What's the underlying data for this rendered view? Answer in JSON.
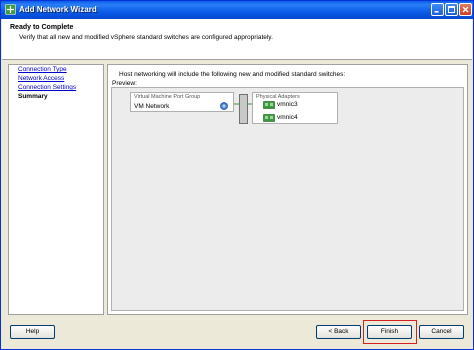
{
  "window": {
    "title": "Add Network Wizard",
    "icon": "network-wizard-icon"
  },
  "header": {
    "title": "Ready to Complete",
    "description": "Verify that all new and modified vSphere standard switches are configured appropriately."
  },
  "nav": {
    "items": [
      {
        "label": "Connection Type",
        "current": false
      },
      {
        "label": "Network Access",
        "current": false
      },
      {
        "label": "Connection Settings",
        "current": false
      },
      {
        "label": "Summary",
        "current": true
      }
    ]
  },
  "main": {
    "intro": "Host networking will include the following new and modified standard switches:",
    "preview_label": "Preview:",
    "port_group": {
      "caption": "Virtual Machine Port Group",
      "name": "VM Network"
    },
    "adapters": {
      "caption": "Physical Adapters",
      "items": [
        "vmnic3",
        "vmnic4"
      ]
    }
  },
  "buttons": {
    "help": "Help",
    "back": "< Back",
    "finish": "Finish",
    "cancel": "Cancel"
  },
  "colors": {
    "title_bar": "#0a5ce8",
    "link": "#0000cc",
    "highlight": "#d62020",
    "connector": "#2f9a2f"
  }
}
